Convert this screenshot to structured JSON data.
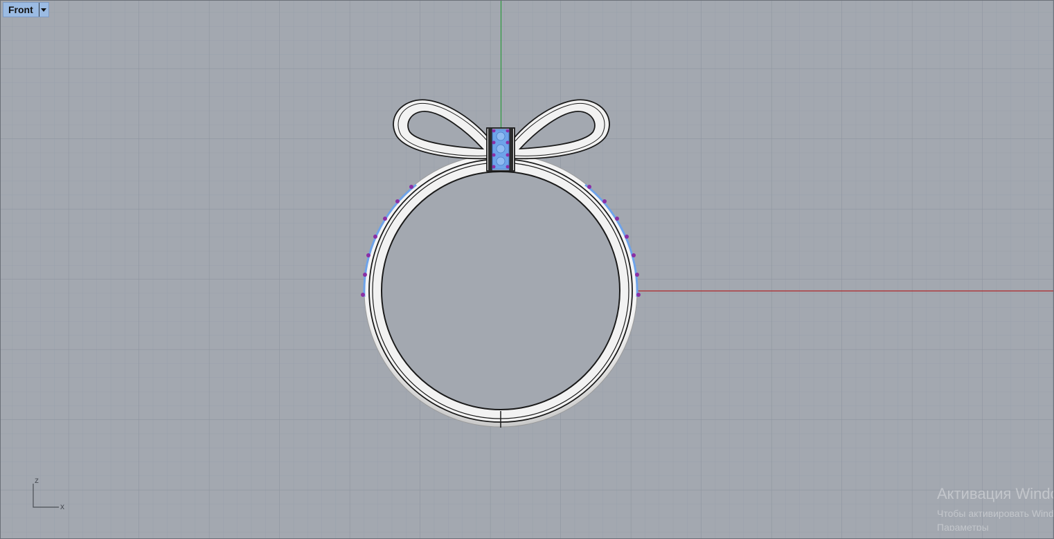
{
  "viewport": {
    "title": "Front",
    "dropdown_icon": "chevron-down-icon",
    "grid_color": "#98a0ab",
    "major_grid_color": "#8c939e",
    "x_axis_color": "#b0262a",
    "y_axis_color": "#2e9a3f"
  },
  "axes_widget": {
    "z_label": "z",
    "x_label": "x"
  },
  "model": {
    "name": "bow-ring",
    "gem_color": "#6ea3ea",
    "prong_color": "#8b2fa5",
    "metal_color": "#efefef"
  },
  "watermark": {
    "line1": "Активация Windows",
    "line2": "Чтобы активировать Windows, перейдите в раздел",
    "line3": "Параметры"
  }
}
